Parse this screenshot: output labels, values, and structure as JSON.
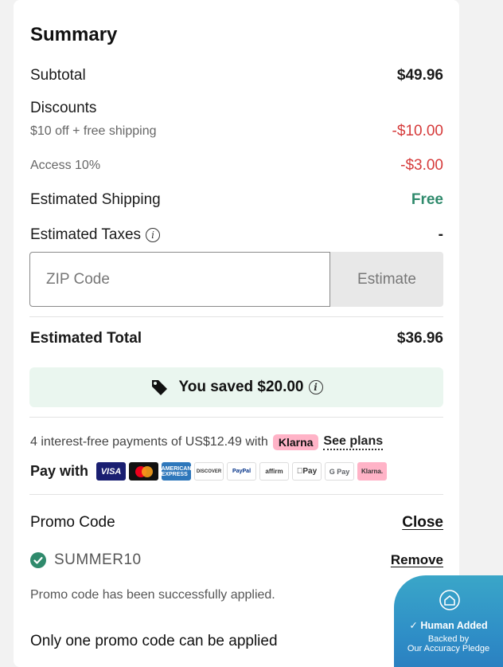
{
  "summary": {
    "title": "Summary",
    "subtotal_label": "Subtotal",
    "subtotal_value": "$49.96",
    "discounts_label": "Discounts",
    "discount1_label": "$10 off + free shipping",
    "discount1_value": "-$10.00",
    "discount2_label": "Access 10%",
    "discount2_value": "-$3.00",
    "shipping_label": "Estimated Shipping",
    "shipping_value": "Free",
    "taxes_label": "Estimated Taxes",
    "taxes_value": "-",
    "zip_placeholder": "ZIP Code",
    "estimate_label": "Estimate",
    "total_label": "Estimated Total",
    "total_value": "$36.96",
    "saved_text": "You saved $20.00"
  },
  "payments": {
    "klarna_prefix": "4 interest-free payments of US$12.49 with",
    "klarna_badge": "Klarna",
    "see_plans": "See plans",
    "pay_with": "Pay with",
    "methods": [
      "VISA",
      "",
      "AMERICAN EXPRESS",
      "DISCOVER",
      "PayPal",
      "affirm",
      "Pay",
      "G Pay",
      "Klarna."
    ]
  },
  "promo": {
    "title": "Promo Code",
    "close_label": "Close",
    "code": "SUMMER10",
    "remove_label": "Remove",
    "success_msg": "Promo code has been successfully applied.",
    "limit_msg": "Only one promo code can be applied"
  },
  "pledge": {
    "heading": "Human Added",
    "line1": "Backed by",
    "line2": "Our Accuracy Pledge"
  },
  "colors": {
    "discount_red": "#d63b3b",
    "free_green": "#2f8a6c",
    "saved_bg": "#eaf6ef",
    "klarna_pink": "#ffb3c7"
  }
}
